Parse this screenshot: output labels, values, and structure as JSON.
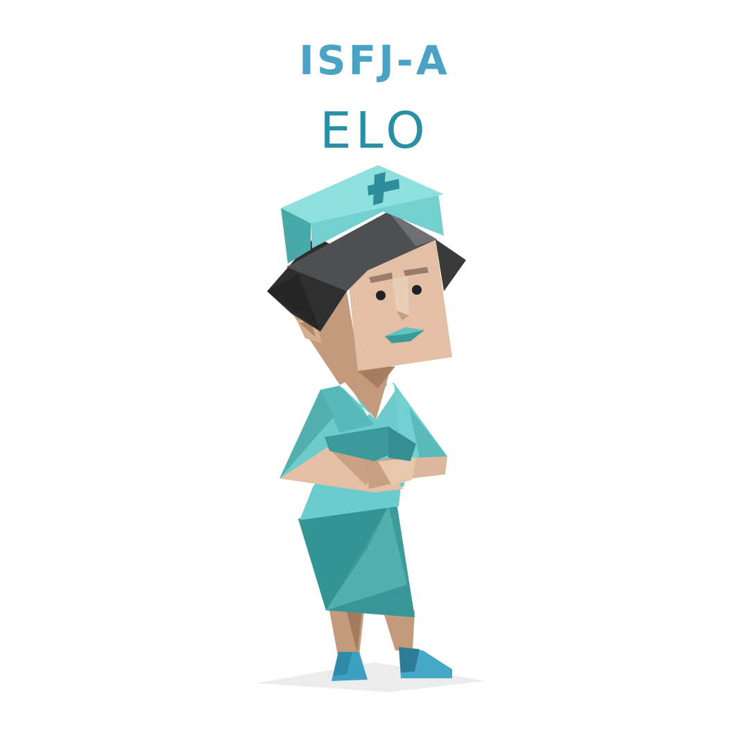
{
  "header": {
    "type_code": "ISFJ-A",
    "name": "ELO"
  },
  "illustration": {
    "subject": "nurse-character",
    "icon": "nurse-character-icon"
  },
  "colors": {
    "type_code": "#4aa3c4",
    "name": "#2a8fa3",
    "teal_light": "#8fe0de",
    "teal_mid": "#6dcccd",
    "teal_dark": "#3a9b9a",
    "hair_dark": "#333333",
    "skin": "#e2bfa5"
  }
}
